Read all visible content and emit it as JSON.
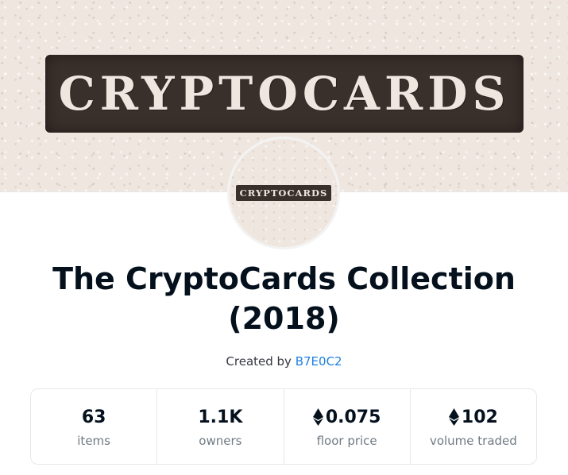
{
  "banner": {
    "text": "CRYPTOCARDS"
  },
  "avatar": {
    "text": "CRYPTOCARDS"
  },
  "collection": {
    "title": "The CryptoCards Collection (2018)",
    "created_by_label": "Created by",
    "creator_name": "B7E0C2"
  },
  "stats": [
    {
      "value": "63",
      "label": "items",
      "icon": ""
    },
    {
      "value": "1.1K",
      "label": "owners",
      "icon": ""
    },
    {
      "value": "0.075",
      "label": "floor price",
      "icon": "eth-icon"
    },
    {
      "value": "102",
      "label": "volume traded",
      "icon": "eth-icon"
    }
  ]
}
